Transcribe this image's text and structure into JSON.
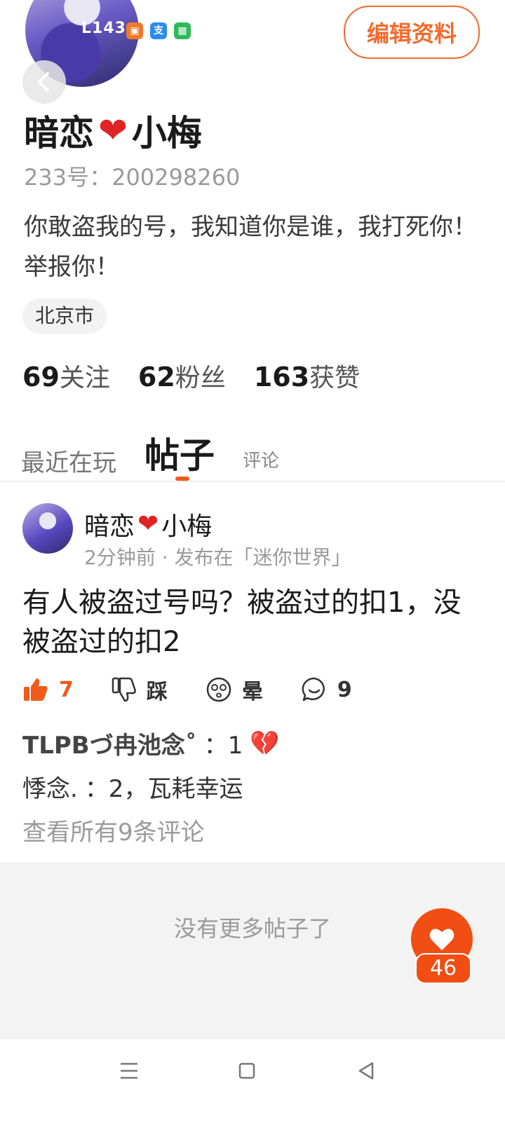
{
  "profile": {
    "level": "143",
    "edit_label": "编辑资料",
    "username": "暗恋",
    "username_suffix": "小梅",
    "uid": "233号：200298260",
    "bio": "你敢盗我的号，我知道你是谁，我打死你！举报你！",
    "location": "北京市",
    "badges": [
      {
        "icon": "book-badge-icon",
        "color": "#f07a2a",
        "glyph": "📖"
      },
      {
        "icon": "alipay-badge-icon",
        "color": "#2a8cf0",
        "glyph": "支"
      },
      {
        "icon": "android-badge-icon",
        "color": "#2dbb5a",
        "glyph": "⬢"
      }
    ]
  },
  "stats": [
    {
      "num": "69",
      "label": "关注"
    },
    {
      "num": "62",
      "label": "粉丝"
    },
    {
      "num": "163",
      "label": "获赞"
    }
  ],
  "tabs": [
    {
      "label": "最近在玩",
      "active": false
    },
    {
      "label": "帖子",
      "active": true
    },
    {
      "label": "评论",
      "active": false
    }
  ],
  "post": {
    "author": "暗恋",
    "author_suffix": "小梅",
    "meta": "2分钟前 · 发布在「迷你世界」",
    "body": "有人被盗过号吗？被盗过的扣1，没被盗过的扣2",
    "actions": {
      "like_count": "7",
      "dislike_label": "踩",
      "dizzy_label": "晕",
      "comment_count": "9"
    },
    "comments": [
      {
        "user": "TLPBづ冉池念˚",
        "text": "：1"
      },
      {
        "user": "悸念.",
        "text": "：2，瓦耗幸运"
      }
    ],
    "view_all": "查看所有9条评论"
  },
  "footer": {
    "no_more": "没有更多帖子了",
    "fab_count": "46"
  },
  "colors": {
    "accent": "#f25a1a",
    "heart": "#e02424"
  }
}
